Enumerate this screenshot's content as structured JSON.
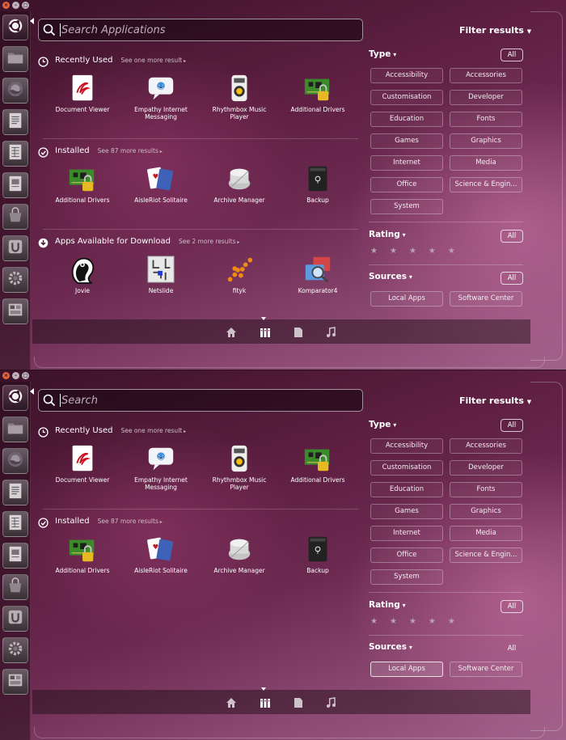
{
  "panels": [
    {
      "search": {
        "placeholder": "Search Applications",
        "value": ""
      },
      "filter_header": "Filter results",
      "categories": [
        {
          "title": "Recently Used",
          "more": "See one more result",
          "apps": [
            {
              "label": "Document Viewer",
              "icon": "document-viewer-icon"
            },
            {
              "label": "Empathy Internet Messaging",
              "icon": "empathy-icon"
            },
            {
              "label": "Rhythmbox Music Player",
              "icon": "rhythmbox-icon"
            },
            {
              "label": "Additional Drivers",
              "icon": "additional-drivers-icon"
            }
          ]
        },
        {
          "title": "Installed",
          "more": "See 87 more results",
          "apps": [
            {
              "label": "Additional Drivers",
              "icon": "additional-drivers-icon"
            },
            {
              "label": "AisleRiot Solitaire",
              "icon": "solitaire-icon"
            },
            {
              "label": "Archive Manager",
              "icon": "archive-manager-icon"
            },
            {
              "label": "Backup",
              "icon": "backup-icon"
            }
          ]
        },
        {
          "title": "Apps Available for Download",
          "more": "See 2 more results",
          "apps": [
            {
              "label": "Jovie",
              "icon": "jovie-icon"
            },
            {
              "label": "Netslide",
              "icon": "netslide-icon"
            },
            {
              "label": "fityk",
              "icon": "fityk-icon"
            },
            {
              "label": "Komparator4",
              "icon": "komparator-icon"
            }
          ]
        }
      ],
      "filters": {
        "type": {
          "title": "Type",
          "all": "All",
          "options": [
            "Accessibility",
            "Accessories",
            "Customisation",
            "Developer",
            "Education",
            "Fonts",
            "Games",
            "Graphics",
            "Internet",
            "Media",
            "Office",
            "Science & Engin...",
            "System"
          ]
        },
        "rating": {
          "title": "Rating",
          "all": "All",
          "stars": 5
        },
        "sources": {
          "title": "Sources",
          "all": "All",
          "options": [
            "Local Apps",
            "Software Center"
          ],
          "active": ""
        }
      }
    },
    {
      "search": {
        "placeholder": "Search",
        "value": ""
      },
      "filter_header": "Filter results",
      "categories": [
        {
          "title": "Recently Used",
          "more": "See one more result",
          "apps": [
            {
              "label": "Document Viewer",
              "icon": "document-viewer-icon"
            },
            {
              "label": "Empathy Internet Messaging",
              "icon": "empathy-icon"
            },
            {
              "label": "Rhythmbox Music Player",
              "icon": "rhythmbox-icon"
            },
            {
              "label": "Additional Drivers",
              "icon": "additional-drivers-icon"
            }
          ]
        },
        {
          "title": "Installed",
          "more": "See 87 more results",
          "apps": [
            {
              "label": "Additional Drivers",
              "icon": "additional-drivers-icon"
            },
            {
              "label": "AisleRiot Solitaire",
              "icon": "solitaire-icon"
            },
            {
              "label": "Archive Manager",
              "icon": "archive-manager-icon"
            },
            {
              "label": "Backup",
              "icon": "backup-icon"
            }
          ]
        }
      ],
      "filters": {
        "type": {
          "title": "Type",
          "all": "All",
          "options": [
            "Accessibility",
            "Accessories",
            "Customisation",
            "Developer",
            "Education",
            "Fonts",
            "Games",
            "Graphics",
            "Internet",
            "Media",
            "Office",
            "Science & Engin...",
            "System"
          ]
        },
        "rating": {
          "title": "Rating",
          "all": "All",
          "stars": 5
        },
        "sources": {
          "title": "Sources",
          "all": "All",
          "options": [
            "Local Apps",
            "Software Center"
          ],
          "active": "Local Apps"
        }
      }
    }
  ],
  "launcher": {
    "items": [
      "ubuntu-icon",
      "folder-icon",
      "firefox-icon",
      "writer-icon",
      "calc-icon",
      "impress-icon",
      "software-center-icon",
      "ubuntu-one-icon",
      "settings-icon",
      "workspace-switcher-icon"
    ]
  },
  "lenses": [
    "home-lens-icon",
    "applications-lens-icon",
    "files-lens-icon",
    "music-lens-icon"
  ],
  "colors": {
    "accent": "#dd4814",
    "background": "#5e1f42"
  }
}
